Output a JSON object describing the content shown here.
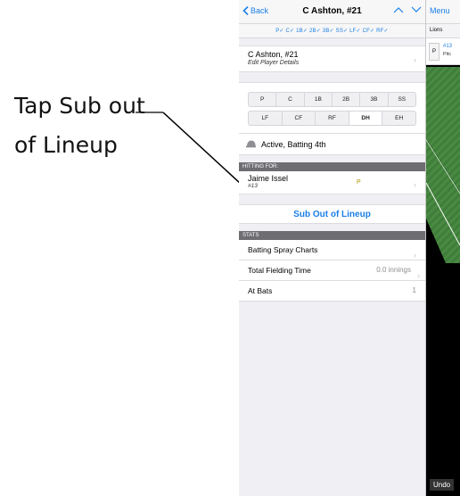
{
  "annotation": {
    "line1": "Tap Sub out",
    "line2": "of Lineup"
  },
  "nav": {
    "back_label": "Back",
    "title": "C Ashton, #21"
  },
  "position_summary": "P✓ C✓ 1B✓ 2B✓ 3B✓ SS✓ LF✓ CF✓ RF✓",
  "player": {
    "name": "C Ashton, #21",
    "edit_label": "Edit Player Details"
  },
  "positions": {
    "row1": [
      "P",
      "C",
      "1B",
      "2B",
      "3B",
      "SS"
    ],
    "row2": [
      "LF",
      "CF",
      "RF",
      "DH",
      "EH"
    ],
    "selected": "DH"
  },
  "status": "Active, Batting 4th",
  "hitting_for": {
    "header": "HITTING FOR:",
    "name": "Jaime Issel",
    "number": "#13",
    "position": "P"
  },
  "sub_out_label": "Sub Out of Lineup",
  "stats": {
    "header": "STATS",
    "rows": [
      {
        "label": "Batting Spray Charts",
        "value": ""
      },
      {
        "label": "Total Fielding Time",
        "value": "0.0 innings"
      },
      {
        "label": "At Bats",
        "value": "1"
      }
    ]
  },
  "right_panel": {
    "menu_label": "Menu",
    "team": "Lions",
    "card_pos": "P",
    "card_num": "#13",
    "card_sub": "Pitc",
    "undo_label": "Undo"
  },
  "colors": {
    "accent": "#1a7ee8",
    "section_header": "#6d6d72",
    "field_green": "#3f7d3a"
  }
}
